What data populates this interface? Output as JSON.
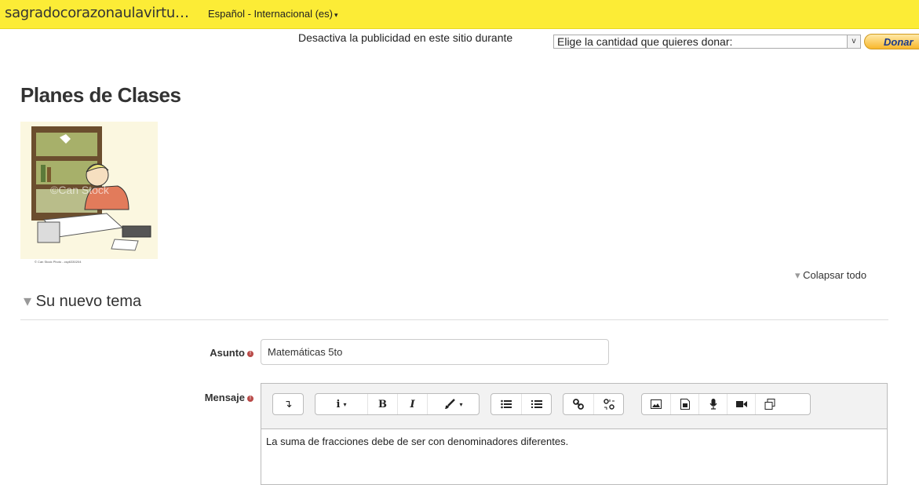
{
  "navbar": {
    "brand": "sagradocorazonaulavirtu…",
    "language": "Español - Internacional (es)",
    "language_caret": "▾"
  },
  "ad": {
    "text": "Desactiva la publicidad en este sitio durante",
    "select_value": "Elige la cantidad que quieres donar:",
    "select_arrow": "v",
    "donate_label": "Donar"
  },
  "page": {
    "title": "Planes de Clases",
    "image_caption": "© Can Stock Photo - csp6330204",
    "watermark": "©Can Stock",
    "collapse_all": "Colapsar todo"
  },
  "section": {
    "title": "Su nuevo tema"
  },
  "form": {
    "subject_label": "Asunto",
    "subject_value": "Matemáticas 5to",
    "message_label": "Mensaje",
    "required_mark": "!",
    "message_content": "La suma de fracciones debe de ser con denominadores diferentes."
  },
  "toolbar": {
    "collapse_btn": "↴",
    "info_btn": "i",
    "bold_btn": "B",
    "italic_btn": "I",
    "caret": "▾"
  },
  "icons": {
    "triangle": "▾",
    "collapse_icon": "collapse-icon",
    "info_icon": "info-icon",
    "bold_icon": "bold-icon",
    "italic_icon": "italic-icon",
    "paint_icon": "paintbrush-icon",
    "unordered_list_icon": "unordered-list-icon",
    "ordered_list_icon": "ordered-list-icon",
    "link_icon": "link-icon",
    "unlink_icon": "unlink-icon",
    "image_icon": "image-icon",
    "media_icon": "media-icon",
    "microphone_icon": "microphone-icon",
    "video_icon": "video-icon",
    "copy_icon": "copy-icon"
  },
  "colors": {
    "navbar_bg": "#fcec36",
    "required": "#b94a48",
    "donate_text": "#1b3a8a"
  }
}
